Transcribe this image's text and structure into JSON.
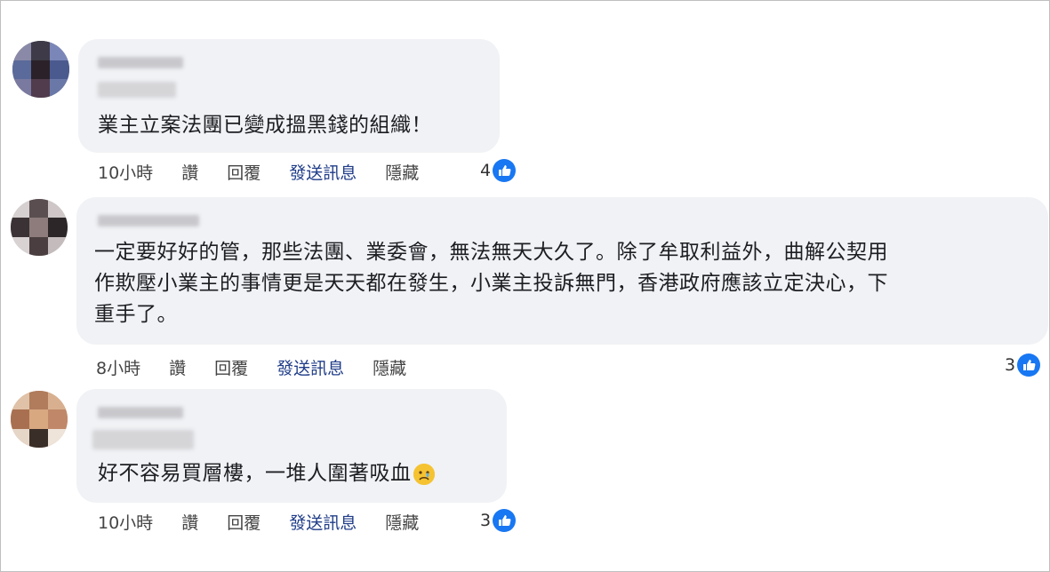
{
  "comments": [
    {
      "text_lines": [
        "業主立案法團已變成搵黑錢的組織！"
      ],
      "time": "10小時",
      "like_label": "讚",
      "reply_label": "回覆",
      "send_label": "發送訊息",
      "hide_label": "隱藏",
      "reaction_count": "4"
    },
    {
      "text_lines": [
        "一定要好好的管，那些法團、業委會，無法無天大久了。除了牟取利益外，曲解公契用",
        "作欺壓小業主的事情更是天天都在發生，小業主投訴無門，香港政府應該立定決心，下",
        "重手了。"
      ],
      "time": "8小時",
      "like_label": "讚",
      "reply_label": "回覆",
      "send_label": "發送訊息",
      "hide_label": "隱藏",
      "reaction_count": "3"
    },
    {
      "text_lines": [
        "好不容易買層樓，一堆人圍著吸血"
      ],
      "emoji": "sad-face-icon",
      "time": "10小時",
      "like_label": "讚",
      "reply_label": "回覆",
      "send_label": "發送訊息",
      "hide_label": "隱藏",
      "reaction_count": "3"
    }
  ],
  "colors": {
    "bubble": "#f0f2f5",
    "like_blue": "#1877f2",
    "send_link": "#1f3c88"
  }
}
